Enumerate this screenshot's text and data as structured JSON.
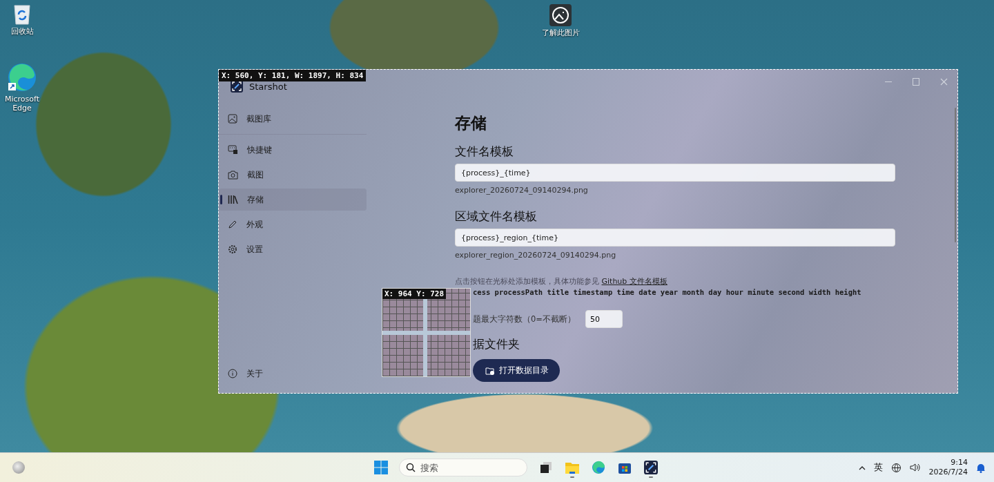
{
  "desktop": {
    "icons": [
      {
        "kind": "recycle",
        "label": "回收站"
      },
      {
        "kind": "edge",
        "label": "Microsoft Edge"
      },
      {
        "kind": "photo-info",
        "label": "了解此图片"
      }
    ]
  },
  "capture": {
    "region_label": "X: 560, Y: 181, W: 1897, H: 834",
    "magnifier_label": "X: 964 Y: 728"
  },
  "window": {
    "title": "Starshot"
  },
  "sidebar": {
    "items": [
      {
        "kind": "gallery",
        "label": "截图库",
        "selected": false
      },
      {
        "kind": "keyboard",
        "label": "快捷键",
        "selected": false
      },
      {
        "kind": "camera",
        "label": "截图",
        "selected": false
      },
      {
        "kind": "library",
        "label": "存储",
        "selected": true
      },
      {
        "kind": "pen",
        "label": "外观",
        "selected": false
      },
      {
        "kind": "gear",
        "label": "设置",
        "selected": false
      }
    ],
    "footer": {
      "label": "关于"
    }
  },
  "content": {
    "heading": "存储",
    "filename_template": {
      "label": "文件名模板",
      "value": "{process}_{time}",
      "preview": "explorer_20260724_09140294.png"
    },
    "region_template": {
      "label": "区域文件名模板",
      "value": "{process}_region_{time}",
      "preview": "explorer_region_20260724_09140294.png"
    },
    "hint": "点击按钮在光标处添加模板，具体功能参见 ",
    "hint_link": "Github 文件名模板",
    "variables": "cess processPath title timestamp time date year month day hour minute second width height",
    "max_chars": {
      "label": "题最大字符数（0=不截断）",
      "value": "50"
    },
    "data_folder": {
      "heading": "据文件夹",
      "button": "打开数据目录"
    }
  },
  "taskbar": {
    "search": {
      "placeholder": "搜索"
    },
    "apps": [
      {
        "kind": "task-view",
        "running": false
      },
      {
        "kind": "folder",
        "running": true
      },
      {
        "kind": "edge",
        "running": false
      },
      {
        "kind": "store",
        "running": false
      },
      {
        "kind": "starshot",
        "running": true
      }
    ],
    "input_method": "英",
    "time": "9:14",
    "date": "2026/7/24"
  }
}
